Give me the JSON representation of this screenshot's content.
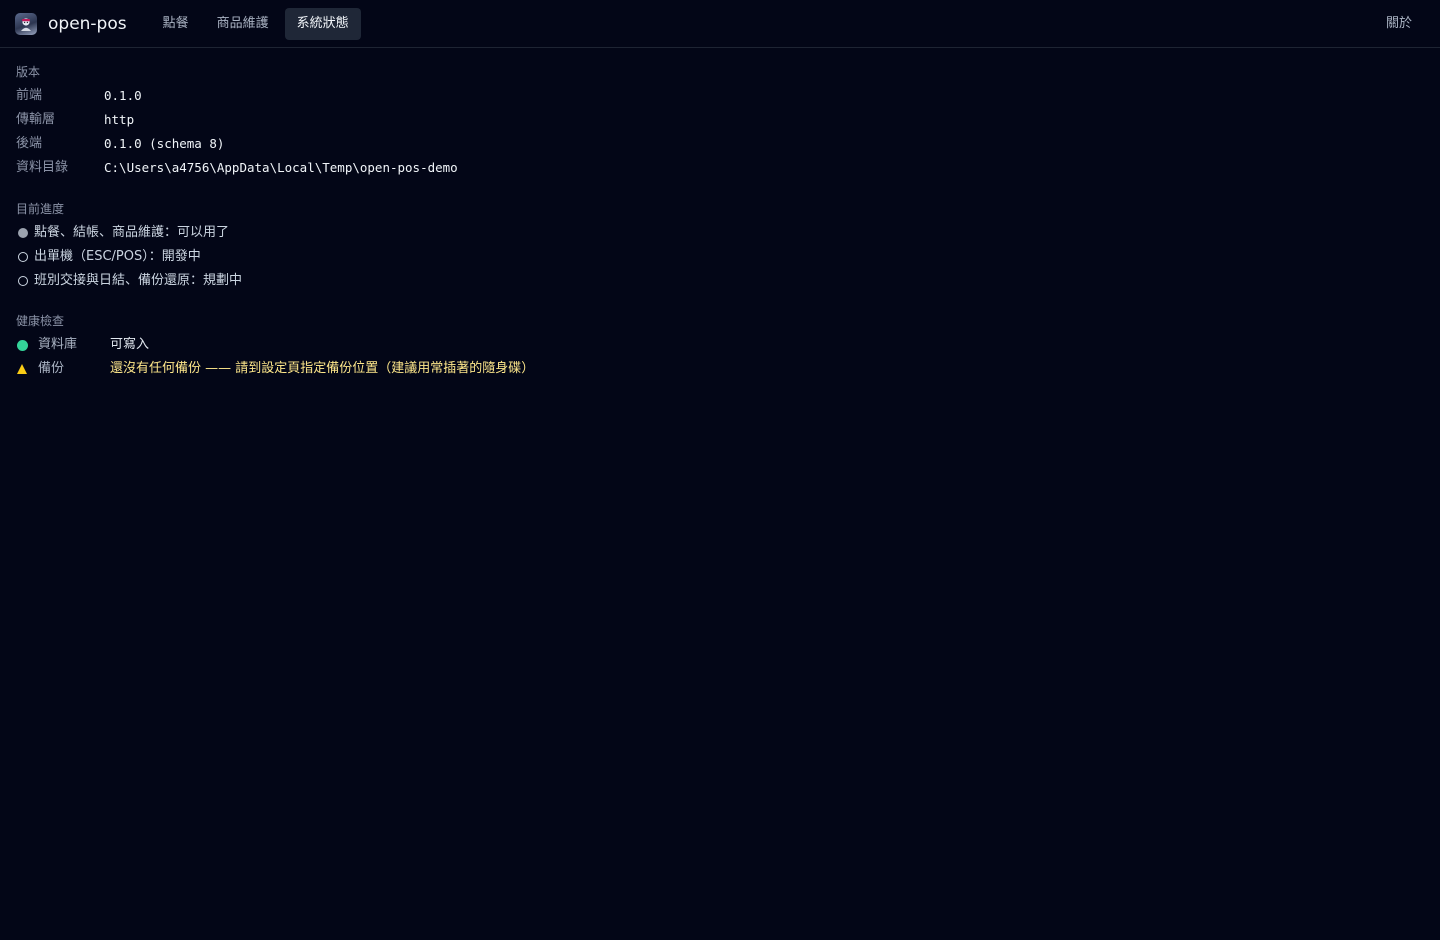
{
  "header": {
    "brand": "open-pos",
    "tabs": [
      {
        "label": "點餐",
        "active": false
      },
      {
        "label": "商品維護",
        "active": false
      },
      {
        "label": "系統狀態",
        "active": true
      }
    ],
    "about_label": "關於"
  },
  "version": {
    "title": "版本",
    "rows": [
      {
        "key": "前端",
        "value": "0.1.0"
      },
      {
        "key": "傳輸層",
        "value": "http"
      },
      {
        "key": "後端",
        "value": "0.1.0 (schema 8)"
      },
      {
        "key": "資料目錄",
        "value": "C:\\Users\\a4756\\AppData\\Local\\Temp\\open-pos-demo"
      }
    ]
  },
  "progress": {
    "title": "目前進度",
    "items": [
      {
        "text": "點餐、結帳、商品維護：可以用了",
        "done": true
      },
      {
        "text": "出單機（ESC/POS）：開發中",
        "done": false
      },
      {
        "text": "班別交接與日結、備份還原：規劃中",
        "done": false
      }
    ]
  },
  "health": {
    "title": "健康檢查",
    "items": [
      {
        "icon": "ok-dot-icon",
        "label": "資料庫",
        "value": "可寫入",
        "status": "ok"
      },
      {
        "icon": "warning-icon",
        "label": "備份",
        "value": "還沒有任何備份 —— 請到設定頁指定備份位置（建議用常插著的隨身碟）",
        "status": "warn"
      }
    ]
  },
  "colors": {
    "background": "#030617",
    "ok": "#34d399",
    "warn": "#facc15",
    "warn_text": "#fde68a",
    "active_tab": "#1f2737"
  }
}
